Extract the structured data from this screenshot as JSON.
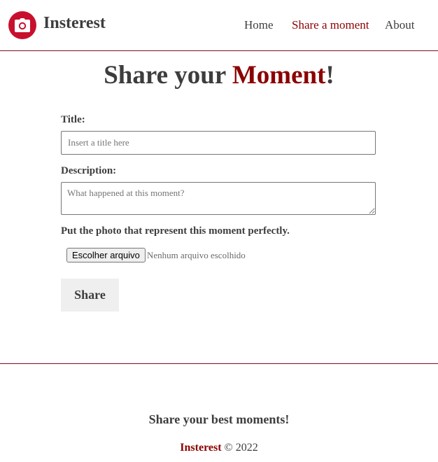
{
  "header": {
    "brand": "Insterest",
    "logo_icon": "camera-icon",
    "nav": [
      {
        "label": "Home"
      },
      {
        "label": "Share a moment",
        "active": true
      },
      {
        "label": "About"
      }
    ]
  },
  "colors": {
    "accent": "#8b0000",
    "logo_bg": "#c8102e",
    "text": "#3d3d3d",
    "divider": "#7a1020"
  },
  "main": {
    "title_prefix": "Share your ",
    "title_accent": "Moment",
    "title_suffix": "!",
    "form": {
      "title_label": "Title:",
      "title_placeholder": "Insert a title here",
      "title_value": "",
      "description_label": "Description:",
      "description_placeholder": "What happened at this moment?",
      "description_value": "",
      "photo_label": "Put the photo that represent this moment perfectly.",
      "file_button": "Escolher arquivo",
      "file_status": "Nenhum arquivo escolhido",
      "submit_label": "Share"
    }
  },
  "footer": {
    "tagline": "Share your best moments!",
    "brand": "Insterest",
    "copyright": " © 2022"
  }
}
